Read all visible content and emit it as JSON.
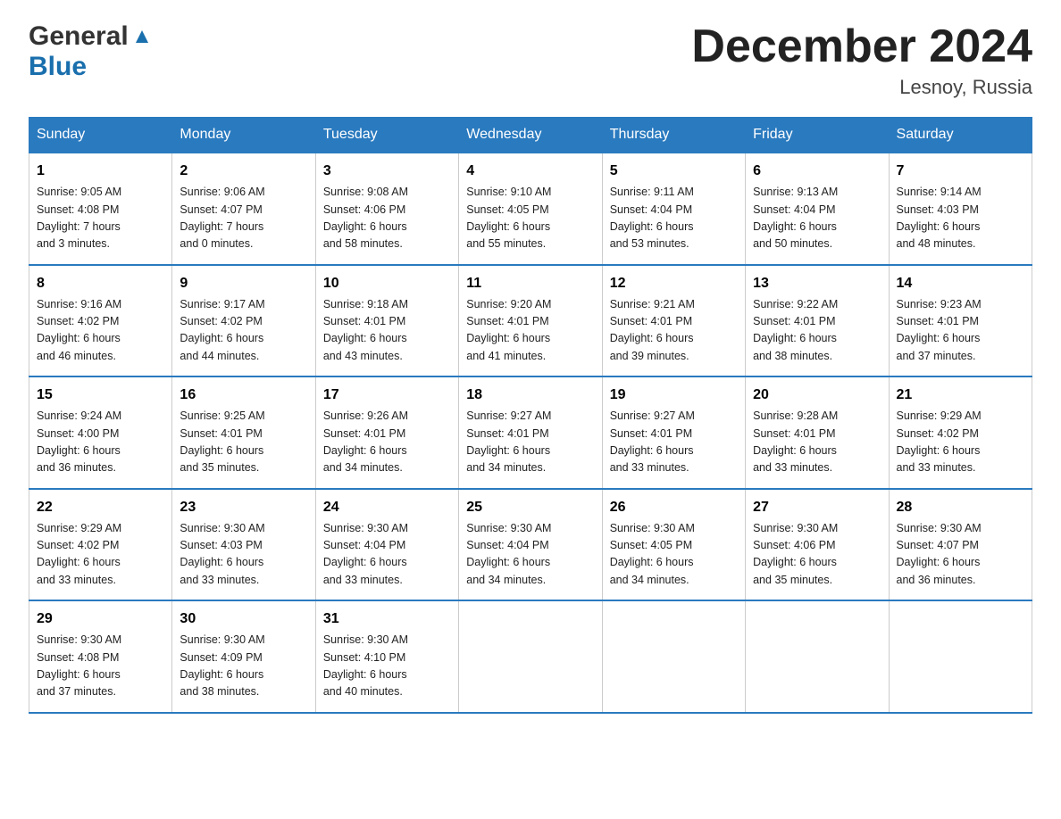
{
  "header": {
    "logo_general": "General",
    "logo_blue": "Blue",
    "month_title": "December 2024",
    "location": "Lesnoy, Russia"
  },
  "days_of_week": [
    "Sunday",
    "Monday",
    "Tuesday",
    "Wednesday",
    "Thursday",
    "Friday",
    "Saturday"
  ],
  "weeks": [
    [
      {
        "num": "1",
        "info": "Sunrise: 9:05 AM\nSunset: 4:08 PM\nDaylight: 7 hours\nand 3 minutes."
      },
      {
        "num": "2",
        "info": "Sunrise: 9:06 AM\nSunset: 4:07 PM\nDaylight: 7 hours\nand 0 minutes."
      },
      {
        "num": "3",
        "info": "Sunrise: 9:08 AM\nSunset: 4:06 PM\nDaylight: 6 hours\nand 58 minutes."
      },
      {
        "num": "4",
        "info": "Sunrise: 9:10 AM\nSunset: 4:05 PM\nDaylight: 6 hours\nand 55 minutes."
      },
      {
        "num": "5",
        "info": "Sunrise: 9:11 AM\nSunset: 4:04 PM\nDaylight: 6 hours\nand 53 minutes."
      },
      {
        "num": "6",
        "info": "Sunrise: 9:13 AM\nSunset: 4:04 PM\nDaylight: 6 hours\nand 50 minutes."
      },
      {
        "num": "7",
        "info": "Sunrise: 9:14 AM\nSunset: 4:03 PM\nDaylight: 6 hours\nand 48 minutes."
      }
    ],
    [
      {
        "num": "8",
        "info": "Sunrise: 9:16 AM\nSunset: 4:02 PM\nDaylight: 6 hours\nand 46 minutes."
      },
      {
        "num": "9",
        "info": "Sunrise: 9:17 AM\nSunset: 4:02 PM\nDaylight: 6 hours\nand 44 minutes."
      },
      {
        "num": "10",
        "info": "Sunrise: 9:18 AM\nSunset: 4:01 PM\nDaylight: 6 hours\nand 43 minutes."
      },
      {
        "num": "11",
        "info": "Sunrise: 9:20 AM\nSunset: 4:01 PM\nDaylight: 6 hours\nand 41 minutes."
      },
      {
        "num": "12",
        "info": "Sunrise: 9:21 AM\nSunset: 4:01 PM\nDaylight: 6 hours\nand 39 minutes."
      },
      {
        "num": "13",
        "info": "Sunrise: 9:22 AM\nSunset: 4:01 PM\nDaylight: 6 hours\nand 38 minutes."
      },
      {
        "num": "14",
        "info": "Sunrise: 9:23 AM\nSunset: 4:01 PM\nDaylight: 6 hours\nand 37 minutes."
      }
    ],
    [
      {
        "num": "15",
        "info": "Sunrise: 9:24 AM\nSunset: 4:00 PM\nDaylight: 6 hours\nand 36 minutes."
      },
      {
        "num": "16",
        "info": "Sunrise: 9:25 AM\nSunset: 4:01 PM\nDaylight: 6 hours\nand 35 minutes."
      },
      {
        "num": "17",
        "info": "Sunrise: 9:26 AM\nSunset: 4:01 PM\nDaylight: 6 hours\nand 34 minutes."
      },
      {
        "num": "18",
        "info": "Sunrise: 9:27 AM\nSunset: 4:01 PM\nDaylight: 6 hours\nand 34 minutes."
      },
      {
        "num": "19",
        "info": "Sunrise: 9:27 AM\nSunset: 4:01 PM\nDaylight: 6 hours\nand 33 minutes."
      },
      {
        "num": "20",
        "info": "Sunrise: 9:28 AM\nSunset: 4:01 PM\nDaylight: 6 hours\nand 33 minutes."
      },
      {
        "num": "21",
        "info": "Sunrise: 9:29 AM\nSunset: 4:02 PM\nDaylight: 6 hours\nand 33 minutes."
      }
    ],
    [
      {
        "num": "22",
        "info": "Sunrise: 9:29 AM\nSunset: 4:02 PM\nDaylight: 6 hours\nand 33 minutes."
      },
      {
        "num": "23",
        "info": "Sunrise: 9:30 AM\nSunset: 4:03 PM\nDaylight: 6 hours\nand 33 minutes."
      },
      {
        "num": "24",
        "info": "Sunrise: 9:30 AM\nSunset: 4:04 PM\nDaylight: 6 hours\nand 33 minutes."
      },
      {
        "num": "25",
        "info": "Sunrise: 9:30 AM\nSunset: 4:04 PM\nDaylight: 6 hours\nand 34 minutes."
      },
      {
        "num": "26",
        "info": "Sunrise: 9:30 AM\nSunset: 4:05 PM\nDaylight: 6 hours\nand 34 minutes."
      },
      {
        "num": "27",
        "info": "Sunrise: 9:30 AM\nSunset: 4:06 PM\nDaylight: 6 hours\nand 35 minutes."
      },
      {
        "num": "28",
        "info": "Sunrise: 9:30 AM\nSunset: 4:07 PM\nDaylight: 6 hours\nand 36 minutes."
      }
    ],
    [
      {
        "num": "29",
        "info": "Sunrise: 9:30 AM\nSunset: 4:08 PM\nDaylight: 6 hours\nand 37 minutes."
      },
      {
        "num": "30",
        "info": "Sunrise: 9:30 AM\nSunset: 4:09 PM\nDaylight: 6 hours\nand 38 minutes."
      },
      {
        "num": "31",
        "info": "Sunrise: 9:30 AM\nSunset: 4:10 PM\nDaylight: 6 hours\nand 40 minutes."
      },
      {
        "num": "",
        "info": ""
      },
      {
        "num": "",
        "info": ""
      },
      {
        "num": "",
        "info": ""
      },
      {
        "num": "",
        "info": ""
      }
    ]
  ]
}
